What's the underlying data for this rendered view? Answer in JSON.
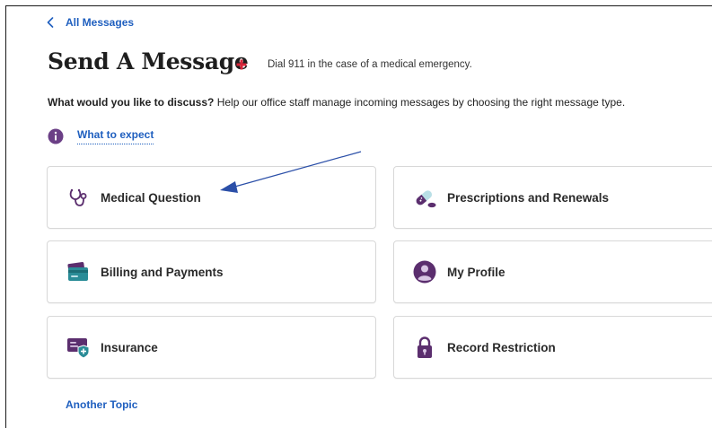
{
  "nav": {
    "back_label": "All Messages"
  },
  "header": {
    "title": "Send A Message",
    "emergency_note": "Dial 911 in the case of a medical emergency."
  },
  "intro": {
    "question": "What would you like to discuss?",
    "helper": " Help our office staff manage incoming messages by choosing the right message type."
  },
  "expect": {
    "label": "What to expect"
  },
  "topics": [
    {
      "label": "Medical Question",
      "icon": "stethoscope-icon"
    },
    {
      "label": "Prescriptions and Renewals",
      "icon": "pills-icon"
    },
    {
      "label": "Billing and Payments",
      "icon": "credit-card-icon"
    },
    {
      "label": "My Profile",
      "icon": "profile-icon"
    },
    {
      "label": "Insurance",
      "icon": "insurance-card-icon"
    },
    {
      "label": "Record Restriction",
      "icon": "lock-icon"
    }
  ],
  "footer": {
    "another_topic": "Another Topic"
  },
  "colors": {
    "link": "#1f5fbf",
    "accent_purple": "#5b2e6e",
    "accent_teal": "#2a8c97",
    "emergency_red": "#d6263a",
    "annotation_arrow": "#2b4fa8"
  }
}
